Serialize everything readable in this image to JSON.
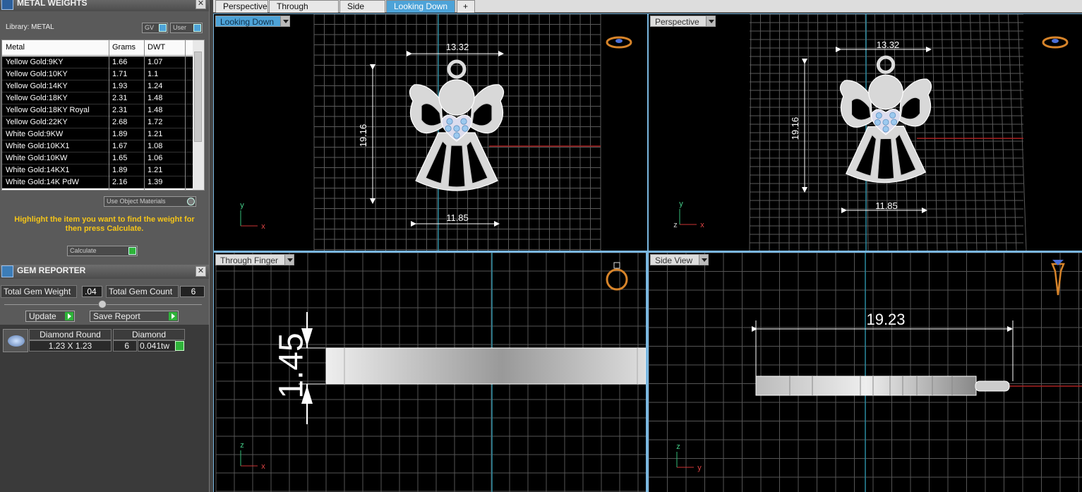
{
  "metal_weights": {
    "title": "METAL WEIGHTS",
    "library": "Library: METAL",
    "gv_label": "GV",
    "user_label": "User",
    "columns": [
      "Metal",
      "Grams",
      "DWT"
    ],
    "rows": [
      {
        "metal": "Yellow Gold:9KY",
        "grams": "1.66",
        "dwt": "1.07"
      },
      {
        "metal": "Yellow Gold:10KY",
        "grams": "1.71",
        "dwt": "1.1"
      },
      {
        "metal": "Yellow Gold:14KY",
        "grams": "1.93",
        "dwt": "1.24"
      },
      {
        "metal": "Yellow Gold:18KY",
        "grams": "2.31",
        "dwt": "1.48"
      },
      {
        "metal": "Yellow Gold:18KY Royal",
        "grams": "2.31",
        "dwt": "1.48"
      },
      {
        "metal": "Yellow Gold:22KY",
        "grams": "2.68",
        "dwt": "1.72"
      },
      {
        "metal": "White Gold:9KW",
        "grams": "1.89",
        "dwt": "1.21"
      },
      {
        "metal": "White Gold:10KX1",
        "grams": "1.67",
        "dwt": "1.08"
      },
      {
        "metal": "White Gold:10KW",
        "grams": "1.65",
        "dwt": "1.06"
      },
      {
        "metal": "White Gold:14KX1",
        "grams": "1.89",
        "dwt": "1.21"
      },
      {
        "metal": "White Gold:14K PdW",
        "grams": "2.16",
        "dwt": "1.39"
      }
    ],
    "use_object_materials": "Use Object Materials",
    "hint": "Highlight the item you want to find the weight for then press Calculate.",
    "calculate_label": "Calculate"
  },
  "gem_reporter": {
    "title": "GEM REPORTER",
    "total_gem_weight_label": "Total Gem Weight",
    "total_gem_weight": ".04",
    "total_gem_count_label": "Total Gem Count",
    "total_gem_count": "6",
    "update_label": "Update",
    "save_report_label": "Save Report",
    "gem": {
      "shape": "Diamond Round",
      "size": "1.23 X 1.23",
      "material": "Diamond",
      "count": "6",
      "weight": "0.041tw"
    }
  },
  "tabs": [
    "Perspective",
    "Through Finger",
    "Side View",
    "Looking Down"
  ],
  "active_tab": "Looking Down",
  "add_tab_label": "+",
  "viewports": {
    "top_left": {
      "label": "Looking Down",
      "width_dim": "13.32",
      "height_dim": "19.16",
      "bottom_dim": "11.85",
      "axis_h": "x",
      "axis_v": "y"
    },
    "top_right": {
      "label": "Perspective",
      "width_dim": "13.32",
      "height_dim": "19.16",
      "bottom_dim": "11.85",
      "axis_h": "x",
      "axis_v": "y",
      "axis_z": "z"
    },
    "bottom_left": {
      "label": "Through Finger",
      "thickness_dim": "1.45",
      "axis_h": "x",
      "axis_v": "z"
    },
    "bottom_right": {
      "label": "Side View",
      "length_dim": "19.23",
      "axis_h": "y",
      "axis_v": "z"
    }
  },
  "colors": {
    "accent": "#4da3d8",
    "hint": "#f5c518",
    "grid": "#6a6a6a",
    "model": "#d8d8d8"
  }
}
